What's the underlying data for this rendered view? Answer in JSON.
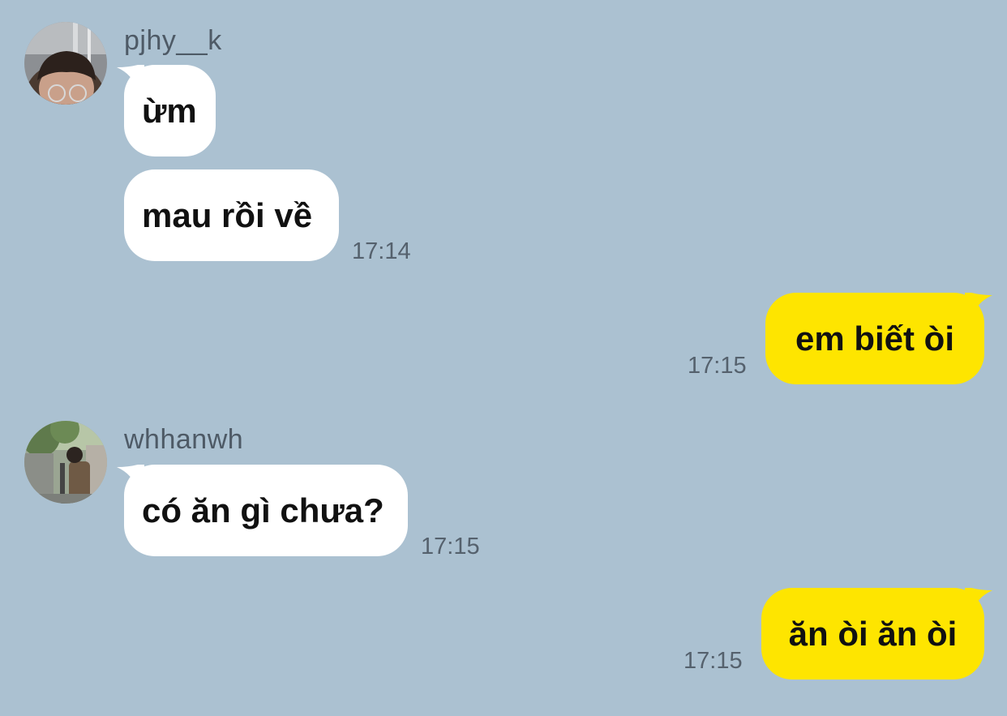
{
  "messages": [
    {
      "sender": "pjhy__k",
      "direction": "incoming",
      "bubbles": [
        "ừm",
        "mau rồi về"
      ],
      "time": "17:14",
      "avatar_icon": "profile-photo-boy-glasses"
    },
    {
      "direction": "outgoing",
      "bubbles": [
        "em biết òi"
      ],
      "time": "17:15"
    },
    {
      "sender": "whhanwh",
      "direction": "incoming",
      "bubbles": [
        "có ăn gì chưa?"
      ],
      "time": "17:15",
      "avatar_icon": "profile-photo-street"
    },
    {
      "direction": "outgoing",
      "bubbles": [
        "ăn òi ăn òi"
      ],
      "time": "17:15"
    }
  ],
  "colors": {
    "background": "#abc1d1",
    "incoming_bubble": "#ffffff",
    "outgoing_bubble": "#fee500",
    "name_text": "#4e5a66",
    "time_text": "#55616d"
  }
}
